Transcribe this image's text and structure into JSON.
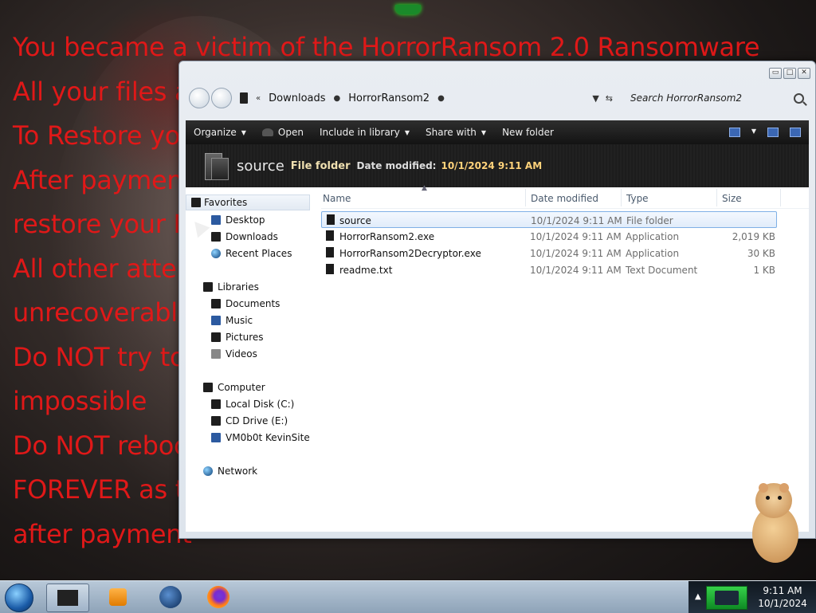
{
  "ransom_note": [
    "You became a victim of the HorrorRansom 2.0 Ransomware",
    "All your files are encrypted",
    "To Restore your files",
    "After payment",
    "restore your M",
    "All other attem",
    "unrecoverable",
    "Do NOT try to d",
    "impossible",
    "Do NOT reboot",
    "FOREVER as the",
    "after payment"
  ],
  "explorer": {
    "address": [
      "Downloads",
      "HorrorRansom2"
    ],
    "search_placeholder": "Search HorrorRansom2",
    "window_controls": {
      "minimize": "▭",
      "maximize": "□",
      "close": "✕"
    },
    "toolbar": {
      "organize": "Organize",
      "open": "Open",
      "include_in_library": "Include in library",
      "share_with": "Share with",
      "new_folder": "New folder"
    },
    "details": {
      "name": "source",
      "type": "File folder",
      "date_label": "Date modified:",
      "date_value": "10/1/2024 9:11 AM"
    },
    "nav_pane": {
      "favorites": "Favorites",
      "desktop": "Desktop",
      "downloads": "Downloads",
      "recent_places": "Recent Places",
      "libraries": "Libraries",
      "documents": "Documents",
      "music": "Music",
      "pictures": "Pictures",
      "videos": "Videos",
      "computer": "Computer",
      "local_disk": "Local Disk (C:)",
      "cd_drive": "CD Drive (E:)",
      "vm_share": "VM0b0t KevinSite",
      "network": "Network"
    },
    "columns": {
      "name": "Name",
      "date": "Date modified",
      "type": "Type",
      "size": "Size"
    },
    "files": [
      {
        "name": "source",
        "date": "10/1/2024 9:11 AM",
        "type": "File folder",
        "size": ""
      },
      {
        "name": "HorrorRansom2.exe",
        "date": "10/1/2024 9:11 AM",
        "type": "Application",
        "size": "2,019 KB"
      },
      {
        "name": "HorrorRansom2Decryptor.exe",
        "date": "10/1/2024 9:11 AM",
        "type": "Application",
        "size": "30 KB"
      },
      {
        "name": "readme.txt",
        "date": "10/1/2024 9:11 AM",
        "type": "Text Document",
        "size": "1 KB"
      }
    ]
  },
  "taskbar": {
    "time": "9:11 AM",
    "date": "10/1/2024"
  }
}
